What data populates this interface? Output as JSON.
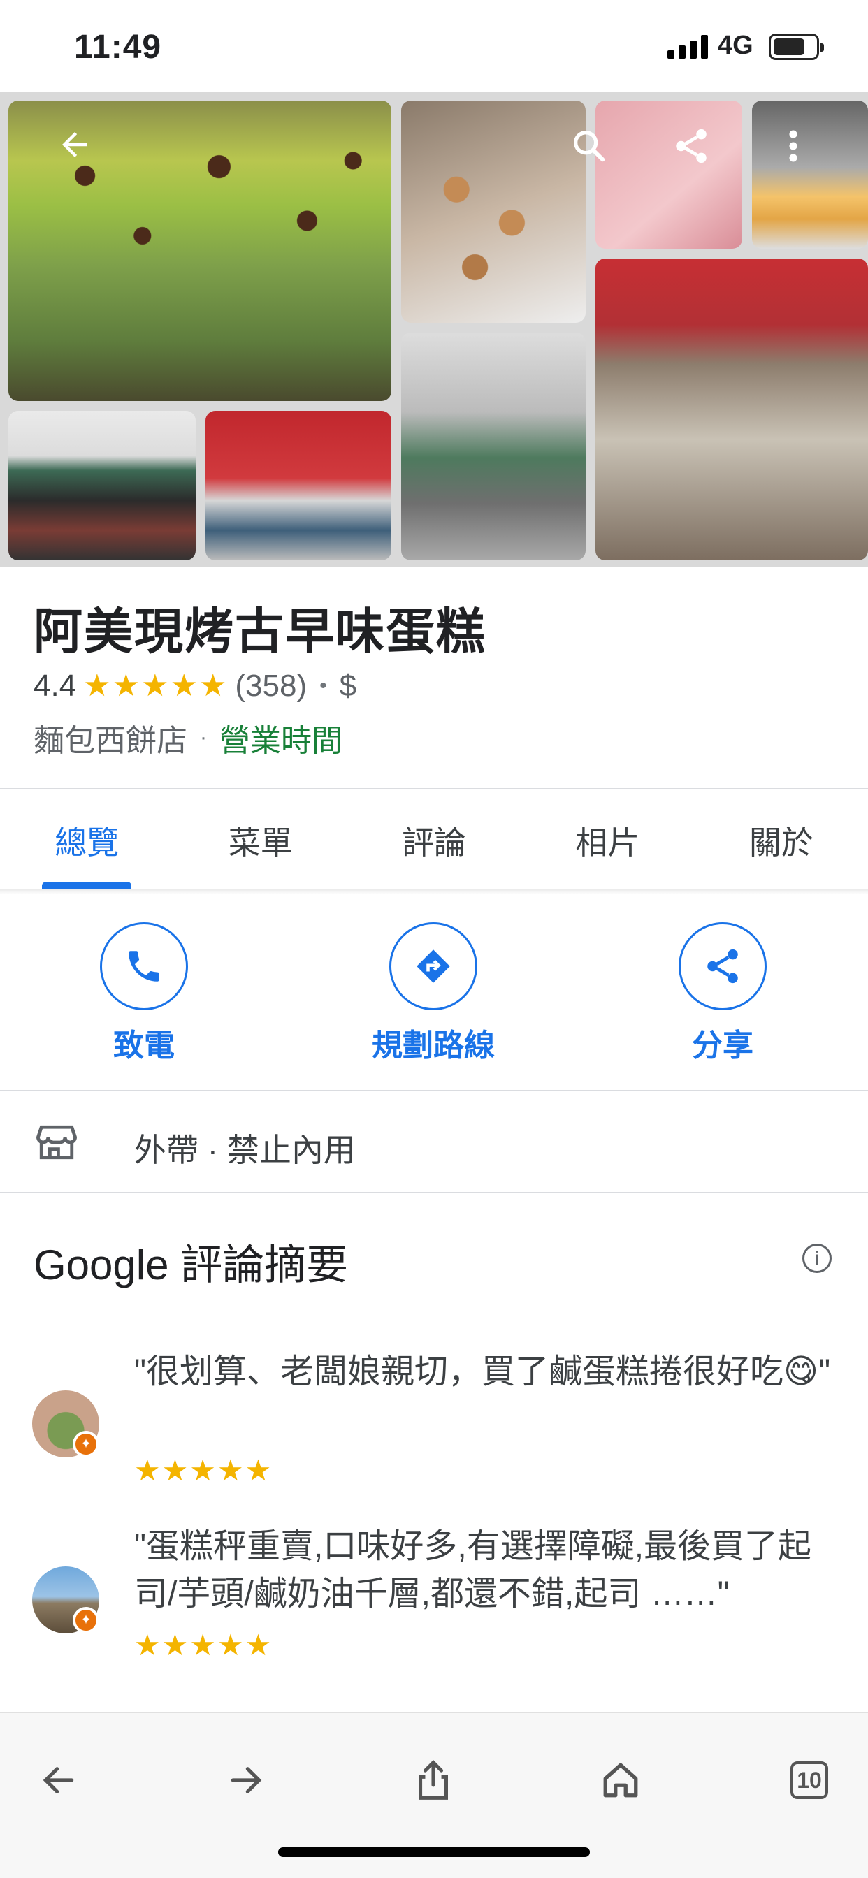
{
  "status_bar": {
    "time": "11:49",
    "network": "4G"
  },
  "photo_icons": {
    "back": "arrow-left-icon",
    "search": "search-icon",
    "share": "share-icon",
    "more": "more-vert-icon"
  },
  "place": {
    "name": "阿美現烤古早味蛋糕",
    "rating": "4.4",
    "stars": "★★★★★",
    "review_count": "(358)",
    "price": "$",
    "category": "麵包西餅店",
    "hours_link": "營業時間",
    "rating_stars_value": 4.4
  },
  "tabs": [
    {
      "label": "總覽",
      "active": true
    },
    {
      "label": "菜單"
    },
    {
      "label": "評論"
    },
    {
      "label": "相片"
    },
    {
      "label": "關於"
    }
  ],
  "actions": {
    "call": "致電",
    "directions": "規劃路線",
    "share": "分享"
  },
  "service": {
    "text": "外帶 · 禁止內用",
    "icon": "store-icon"
  },
  "review_summary": {
    "title": "Google 評論摘要",
    "reviews": [
      {
        "text": "\"很划算、老闆娘親切，買了鹹蛋糕捲很好吃😋\"",
        "stars": "★★★★★"
      },
      {
        "text": "\"蛋糕秤重賣,口味好多,有選擇障礙,最後買了起司/芋頭/鹹奶油千層,都還不錯,起司 ……\"",
        "stars": "★★★★★"
      }
    ]
  },
  "toolbar": {
    "tab_count": "10"
  },
  "colors": {
    "accent": "#1a73e8",
    "star": "#f4b400",
    "open_green": "#188038"
  }
}
